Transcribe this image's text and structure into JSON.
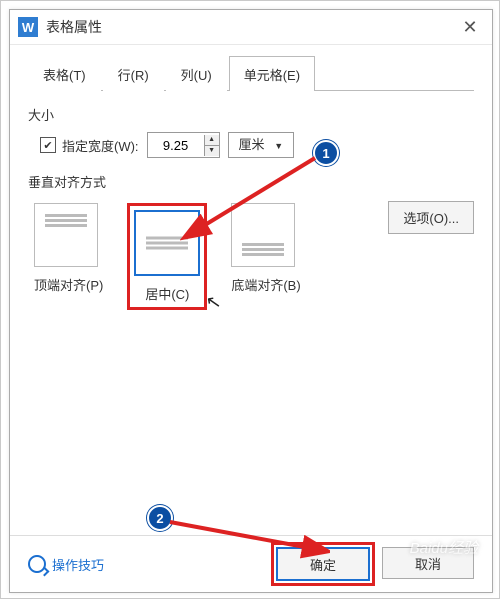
{
  "window": {
    "title": "表格属性",
    "app_icon_letter": "W"
  },
  "tabs": {
    "table": "表格(T)",
    "row": "行(R)",
    "column": "列(U)",
    "cell": "单元格(E)"
  },
  "size": {
    "section": "大小",
    "checkbox_label": "指定宽度(W):",
    "width_value": "9.25",
    "unit": "厘米"
  },
  "valign": {
    "section": "垂直对齐方式",
    "top": "顶端对齐(P)",
    "center": "居中(C)",
    "bottom": "底端对齐(B)"
  },
  "options_button": "选项(O)...",
  "footer": {
    "tip": "操作技巧",
    "ok": "确定",
    "cancel": "取消"
  },
  "annotations": {
    "step1": "1",
    "step2": "2"
  },
  "watermark": "Baidu经验"
}
